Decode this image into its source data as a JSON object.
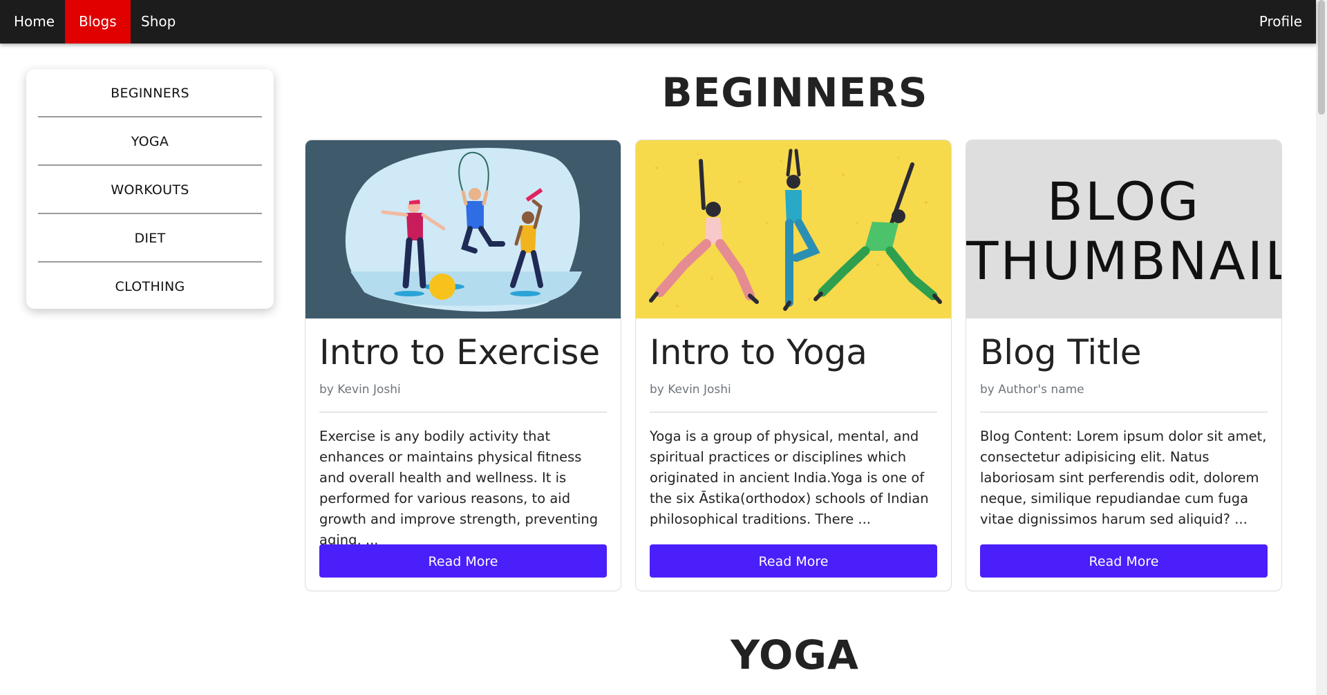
{
  "navbar": {
    "items": [
      {
        "label": "Home"
      },
      {
        "label": "Blogs",
        "active": true
      },
      {
        "label": "Shop"
      }
    ],
    "profile_label": "Profile",
    "active_color": "#e00000",
    "background": "#1c1c1c"
  },
  "sidebar": {
    "items": [
      {
        "label": "BEGINNERS"
      },
      {
        "label": "YOGA"
      },
      {
        "label": "WORKOUTS"
      },
      {
        "label": "DIET"
      },
      {
        "label": "CLOTHING"
      }
    ]
  },
  "sections": [
    {
      "heading": "BEGINNERS",
      "cards": [
        {
          "title": "Intro to Exercise",
          "author": "by Kevin Joshi",
          "text": "Exercise is any bodily activity that enhances or maintains physical fitness and overall health and wellness. It is performed for various reasons, to aid growth and improve strength, preventing aging, ...",
          "button": "Read More",
          "thumbnail": "exercise-illustration"
        },
        {
          "title": "Intro to Yoga",
          "author": "by Kevin Joshi",
          "text": "Yoga is a group of physical, mental, and spiritual practices or disciplines which originated in ancient India.Yoga is one of the six Āstika(orthodox) schools of Indian philosophical traditions. There ...",
          "button": "Read More",
          "thumbnail": "yoga-illustration"
        },
        {
          "title": "Blog Title",
          "author": "by Author's name",
          "text": "Blog Content: Lorem ipsum dolor sit amet, consectetur adipisicing elit. Natus laboriosam sint perferendis odit, dolorem neque, similique repudiandae cum fuga vitae dignissimos harum sed aliquid? ...",
          "button": "Read More",
          "thumbnail": "blog-thumbnail-placeholder",
          "thumbnail_text": [
            "BLOG",
            "THUMBNAIL"
          ]
        }
      ]
    },
    {
      "heading": "YOGA"
    }
  ],
  "colors": {
    "button": "#4a1ffa",
    "yoga_bg": "#f7d94c",
    "exercise_bg": "#3e5a6b"
  }
}
